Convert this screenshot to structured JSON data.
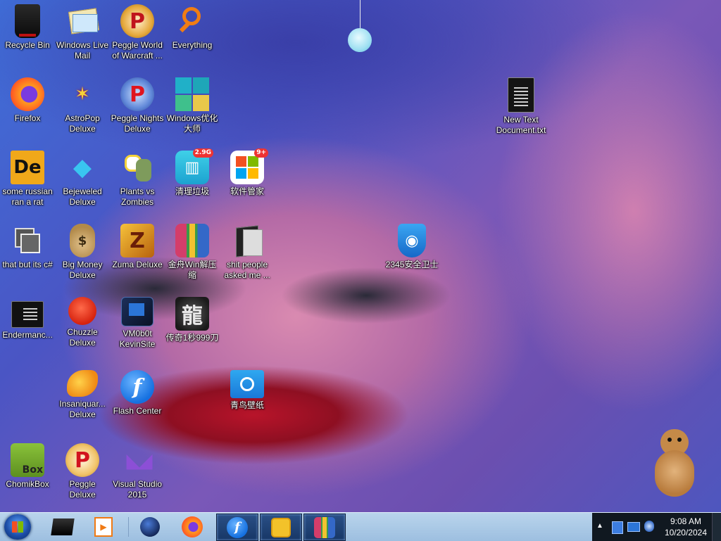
{
  "desktop": {
    "icons": [
      {
        "label": "Recycle Bin"
      },
      {
        "label": "Windows Live Mail"
      },
      {
        "label": "Peggle World of Warcraft ..."
      },
      {
        "label": "Everything"
      },
      {
        "label": "Firefox"
      },
      {
        "label": "AstroPop Deluxe"
      },
      {
        "label": "Peggle Nights Deluxe"
      },
      {
        "label": "Windows优化大师"
      },
      {
        "label": "New Text Document.txt"
      },
      {
        "label": "some russian ran a rat"
      },
      {
        "label": "Bejeweled Deluxe"
      },
      {
        "label": "Plants vs Zombies"
      },
      {
        "label": "清理垃圾",
        "badge": "2.9G"
      },
      {
        "label": "软件管家",
        "badge": "9+"
      },
      {
        "label": "that but its c#"
      },
      {
        "label": "Big Money Deluxe"
      },
      {
        "label": "Zuma Deluxe"
      },
      {
        "label": "金舟Win解压缩"
      },
      {
        "label": "shit people asked me ..."
      },
      {
        "label": "2345安全卫士"
      },
      {
        "label": "Endermanc..."
      },
      {
        "label": "Chuzzle Deluxe"
      },
      {
        "label": "VM0b0t KevinSite"
      },
      {
        "label": "传奇1秒999刀"
      },
      {
        "label": "Insaniquar... Deluxe"
      },
      {
        "label": "Flash Center"
      },
      {
        "label": "青鸟壁纸"
      },
      {
        "label": "ChomikBox"
      },
      {
        "label": "Peggle Deluxe"
      },
      {
        "label": "Visual Studio 2015"
      }
    ]
  },
  "glyphs": {
    "de": "De",
    "p": "P",
    "f": "f",
    "box": "Box",
    "dollar": "$",
    "z": "Z",
    "vs": "◣◢",
    "dragon": "龍",
    "shield": "◉"
  },
  "taskbar": {
    "clock_time": "9:08 AM",
    "clock_date": "10/20/2024"
  },
  "colors": {
    "taskbar": "#b9d4ec",
    "tray": "#101820",
    "accent": "#1d4ea8"
  }
}
